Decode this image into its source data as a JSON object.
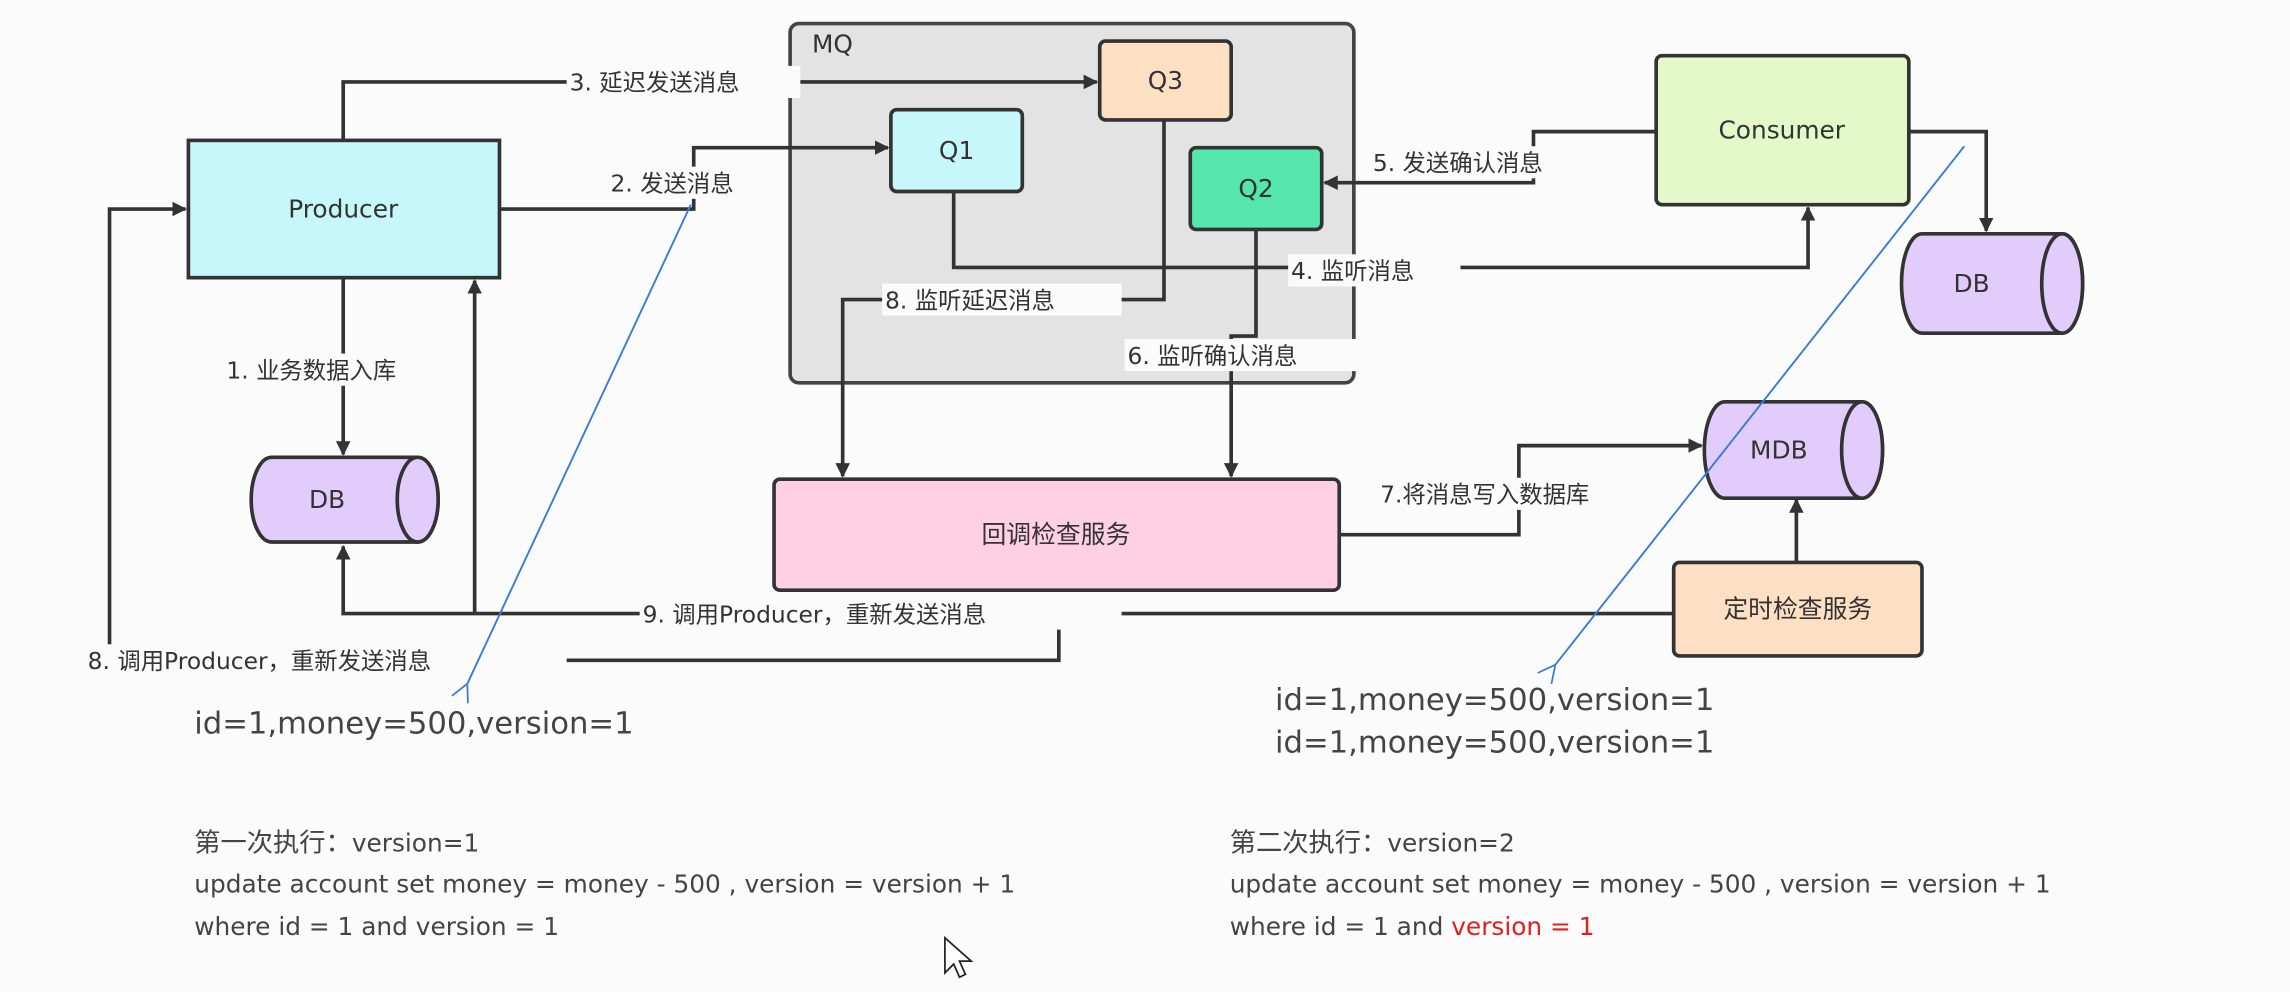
{
  "diagram": {
    "mq_label": "MQ",
    "nodes": {
      "producer": "Producer",
      "consumer": "Consumer",
      "q1": "Q1",
      "q2": "Q2",
      "q3": "Q3",
      "db_left": "DB",
      "db_right": "DB",
      "mdb": "MDB",
      "callback_service": "回调检查服务",
      "timer_service": "定时检查服务"
    },
    "edges": {
      "e1": "1. 业务数据入库",
      "e2": "2. 发送消息",
      "e3": "3. 延迟发送消息",
      "e4": "4. 监听消息",
      "e5": "5. 发送确认消息",
      "e6": "6. 监听确认消息",
      "e7": "7.将消息写入数据库",
      "e8a": "8. 监听延迟消息",
      "e8b": "8. 调用Producer，重新发送消息",
      "e9": "9. 调用Producer，重新发送消息"
    },
    "colors": {
      "producer": "#c6f7fb",
      "q1": "#c6f7fb",
      "q2": "#55e6ad",
      "q3": "#fde0c4",
      "consumer": "#e4f9c9",
      "db": "#e2ccfb",
      "callback": "#ffd0e2",
      "timer": "#fde0c4",
      "mq_bg": "#e3e3e3",
      "annotation": "#3a7bd5",
      "highlight": "#e02020"
    }
  },
  "notes": {
    "left_record": "id=1,money=500,version=1",
    "right_records": [
      "id=1,money=500,version=1",
      "id=1,money=500,version=1"
    ],
    "first": {
      "title": "第一次执行：",
      "title_version": "version=1",
      "sql1": "update account set money = money - 500 , version = version + 1",
      "sql2": "where id = 1 and version = 1"
    },
    "second": {
      "title": "第二次执行：",
      "title_version": "version=2",
      "sql1": "update account set money = money - 500 , version = version + 1",
      "sql2_plain": "where id = 1 and ",
      "sql2_highlight": "version = 1"
    }
  }
}
